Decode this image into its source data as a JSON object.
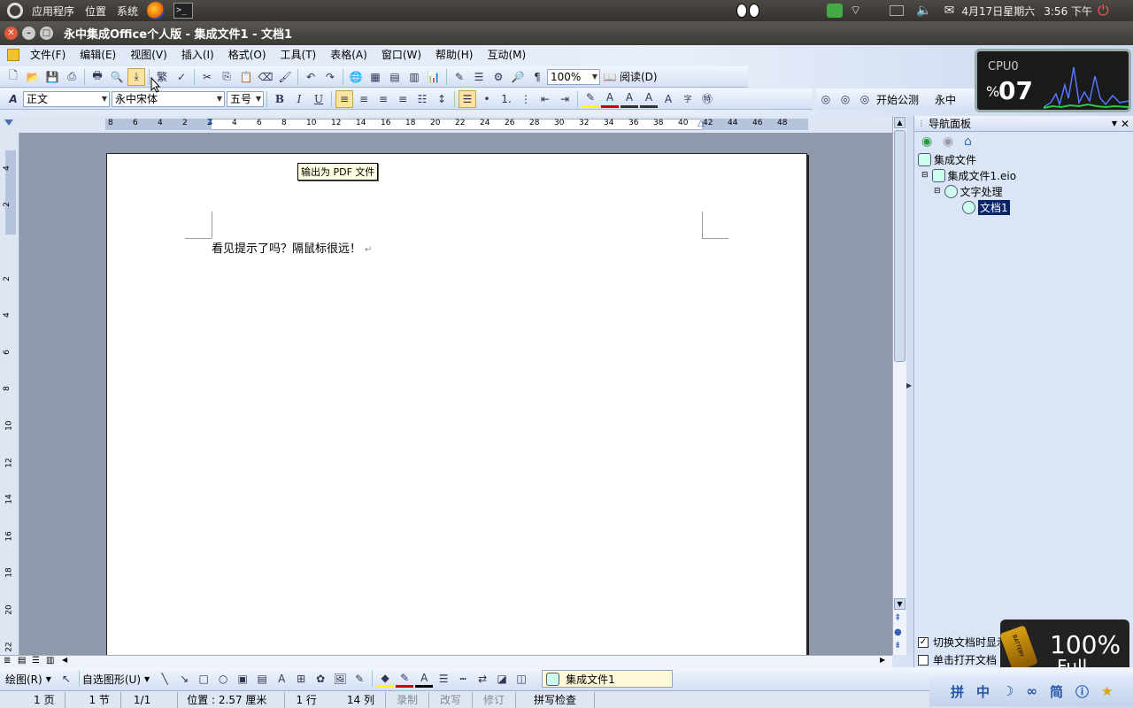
{
  "top_panel": {
    "menus": [
      "应用程序",
      "位置",
      "系统"
    ],
    "datetime": "4月17日星期六",
    "time": "3:56 下午"
  },
  "window": {
    "title": "永中集成Office个人版 - 集成文件1 - 文档1"
  },
  "menubar": [
    "文件(F)",
    "编辑(E)",
    "视图(V)",
    "插入(I)",
    "格式(O)",
    "工具(T)",
    "表格(A)",
    "窗口(W)",
    "帮助(H)",
    "互动(M)"
  ],
  "toolbar": {
    "zoom": "100%",
    "read_label": "阅读(D)",
    "traditional_label": "繁"
  },
  "format_bar": {
    "style": "正文",
    "font": "永中宋体",
    "size": "五号",
    "bold": "B",
    "italic": "I",
    "underline": "U"
  },
  "ruler_numbers": [
    "8",
    "6",
    "4",
    "2",
    "2",
    "4",
    "6",
    "8",
    "10",
    "12",
    "14",
    "16",
    "18",
    "20",
    "22",
    "24",
    "26",
    "28",
    "30",
    "32",
    "34",
    "36",
    "38",
    "40",
    "42",
    "44",
    "46",
    "48"
  ],
  "vruler_numbers": [
    "4",
    "2",
    "2",
    "4",
    "6",
    "8",
    "10",
    "12",
    "14",
    "16",
    "18",
    "20",
    "22"
  ],
  "tooltip": "输出为 PDF 文件",
  "document": {
    "text": "看见提示了吗？隔鼠标很远！"
  },
  "toolbar_right": {
    "tab1": "开始公测",
    "tab2": "永中"
  },
  "nav_panel": {
    "title": "导航面板",
    "tree": {
      "root": "集成文件",
      "file": "集成文件1.eio",
      "category": "文字处理",
      "doc": "文档1"
    },
    "checkbox1": "切换文档时显示",
    "checkbox2": "单击打开文档"
  },
  "cpu_widget": {
    "label": "CPU0",
    "percent_sign": "%",
    "value": "07"
  },
  "battery_widget": {
    "percent": "100%",
    "state": "Full",
    "brand": "BATTERY"
  },
  "drawbar": {
    "draw_label": "绘图(R)",
    "autoshape_label": "自选图形(U)",
    "doc_tab": "集成文件1"
  },
  "ime": [
    "拼",
    "中",
    "简"
  ],
  "statusbar": {
    "page": "1 页",
    "section": "1 节",
    "pages": "1/1",
    "position": "位置 : 2.57 厘米",
    "line": "1 行",
    "column": "14 列",
    "record": "录制",
    "overwrite": "改写",
    "revise": "修订",
    "spell": "拼写检查"
  }
}
